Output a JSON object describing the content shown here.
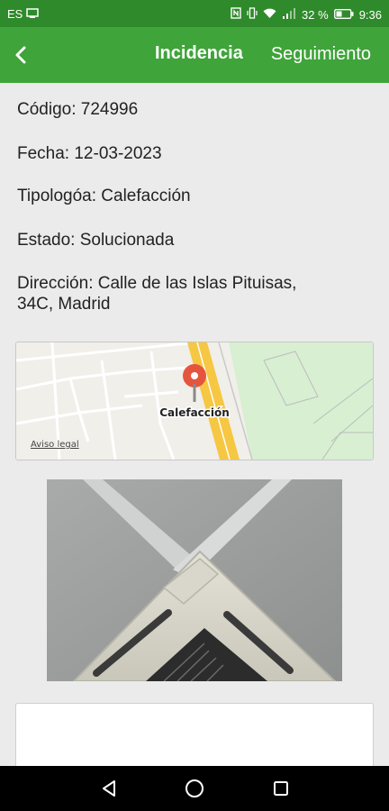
{
  "status_bar": {
    "carrier": "ES",
    "battery_percent": "32 %",
    "time": "9:36"
  },
  "app_bar": {
    "title": "Incidencia",
    "action": "Seguimiento"
  },
  "incident": {
    "codigo": "Código: 724996",
    "fecha": "Fecha: 12-03-2023",
    "tipologia": "Tipologóa: Calefacción",
    "estado": "Estado: Solucionada",
    "direccion_line1": "Dirección: Calle de las Islas Pituisas,",
    "direccion_line2": "34C, Madrid"
  },
  "map": {
    "marker_label": "Calefacción",
    "legal_link": "Aviso legal",
    "colors": {
      "road_yellow": "#f6c743",
      "park_green": "#d8efd2",
      "marker_red": "#e5553e"
    }
  },
  "photo": {
    "icon": "air-conditioner-photo"
  },
  "navigation": {
    "icons": [
      "back-triangle-icon",
      "home-circle-icon",
      "recents-square-icon"
    ]
  },
  "colors": {
    "status_bar": "#2f8a2b",
    "app_bar": "#3fa43a",
    "background": "#ebebeb"
  }
}
